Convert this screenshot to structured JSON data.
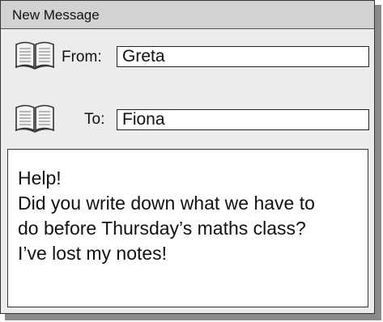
{
  "window": {
    "title": "New Message"
  },
  "from": {
    "label": "From:",
    "value": "Greta",
    "icon": "address-book-icon"
  },
  "to": {
    "label": "To:",
    "value": "Fiona",
    "icon": "address-book-icon"
  },
  "message": {
    "lines": [
      "Help!",
      "Did you write down what we have to",
      "do before Thursday’s maths class?",
      "I’ve lost my notes!"
    ]
  }
}
